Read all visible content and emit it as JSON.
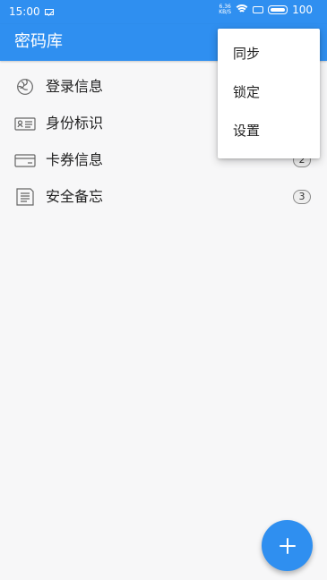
{
  "status_bar": {
    "time": "15:00",
    "network_speed": {
      "value": "6.36",
      "unit": "KB/S"
    },
    "battery": "100",
    "icons": [
      "mail-icon",
      "wifi-icon",
      "screen-icon",
      "battery-icon"
    ]
  },
  "app_bar": {
    "title": "密码库"
  },
  "list": {
    "items": [
      {
        "label": "登录信息",
        "icon": "globe-icon",
        "count": ""
      },
      {
        "label": "身份标识",
        "icon": "id-card-icon",
        "count": ""
      },
      {
        "label": "卡券信息",
        "icon": "card-icon",
        "count": "2"
      },
      {
        "label": "安全备忘",
        "icon": "note-icon",
        "count": "3"
      }
    ]
  },
  "menu": {
    "items": [
      {
        "label": "同步"
      },
      {
        "label": "锁定"
      },
      {
        "label": "设置"
      }
    ]
  },
  "fab": {
    "icon": "plus-icon"
  },
  "colors": {
    "primary": "#2f8ff0",
    "background": "#f7f7f8",
    "text": "#222222"
  }
}
